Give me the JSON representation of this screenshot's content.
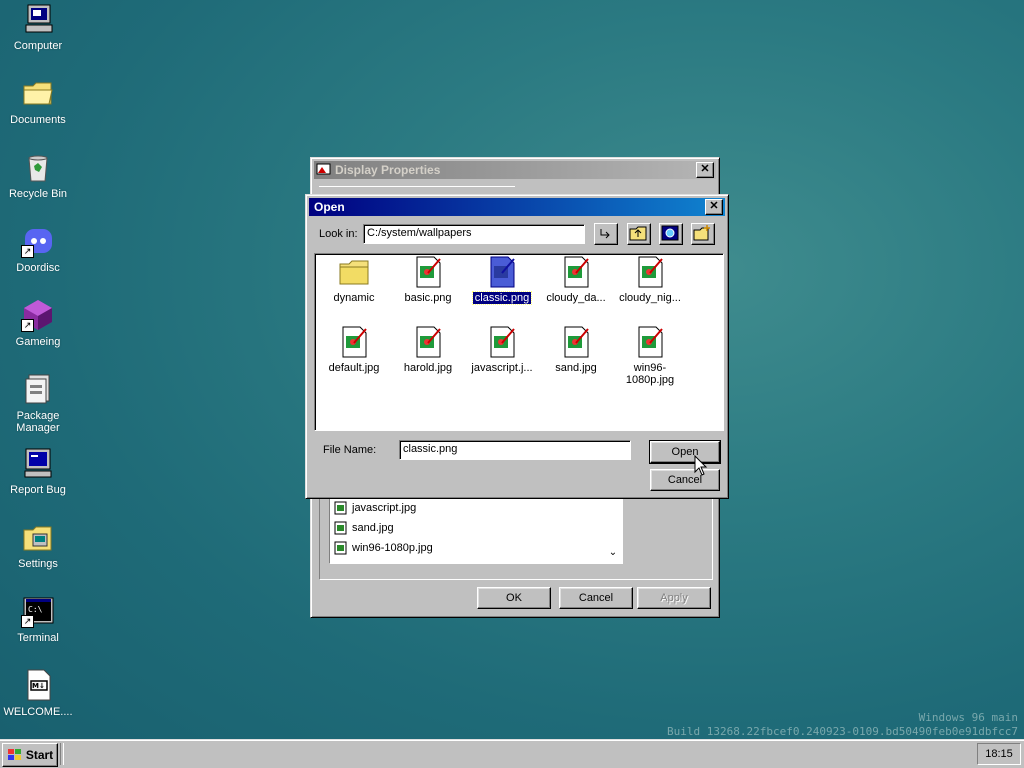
{
  "desktop": {
    "icons": [
      {
        "label": "Computer",
        "icon": "computer-icon"
      },
      {
        "label": "Documents",
        "icon": "folder-icon"
      },
      {
        "label": "Recycle Bin",
        "icon": "recycle-bin-icon"
      },
      {
        "label": "Doordisc",
        "icon": "doordisc-icon"
      },
      {
        "label": "Gameing",
        "icon": "gameing-icon"
      },
      {
        "label": "Package Manager",
        "icon": "package-manager-icon"
      },
      {
        "label": "Report Bug",
        "icon": "report-bug-icon"
      },
      {
        "label": "Settings",
        "icon": "settings-icon"
      },
      {
        "label": "Terminal",
        "icon": "terminal-icon"
      },
      {
        "label": "WELCOME....",
        "icon": "markdown-file-icon"
      }
    ],
    "watermark_line1": "Windows 96 main",
    "watermark_line2": "Build 13268.22fbcef0.240923-0109.bd50490feb0e91dbfcc7"
  },
  "display_properties": {
    "title": "Display Properties",
    "list_items": [
      "javascript.jpg",
      "sand.jpg",
      "win96-1080p.jpg"
    ],
    "ok_label": "OK",
    "cancel_label": "Cancel",
    "apply_label": "Apply"
  },
  "open_dialog": {
    "title": "Open",
    "look_in_label": "Look in:",
    "look_in_value": "C:/system/wallpapers",
    "files": [
      {
        "name": "dynamic",
        "type": "folder",
        "selected": false
      },
      {
        "name": "basic.png",
        "type": "image",
        "selected": false
      },
      {
        "name": "classic.png",
        "type": "image",
        "selected": true
      },
      {
        "name": "cloudy_da...",
        "type": "image",
        "selected": false
      },
      {
        "name": "cloudy_nig...",
        "type": "image",
        "selected": false
      },
      {
        "name": "default.jpg",
        "type": "image",
        "selected": false
      },
      {
        "name": "harold.jpg",
        "type": "image",
        "selected": false
      },
      {
        "name": "javascript.j...",
        "type": "image",
        "selected": false
      },
      {
        "name": "sand.jpg",
        "type": "image",
        "selected": false
      },
      {
        "name": "win96-1080p.jpg",
        "type": "image",
        "selected": false
      }
    ],
    "file_name_label": "File Name:",
    "file_name_value": "classic.png",
    "open_label": "Open",
    "cancel_label": "Cancel"
  },
  "taskbar": {
    "start_label": "Start",
    "clock": "18:15"
  }
}
